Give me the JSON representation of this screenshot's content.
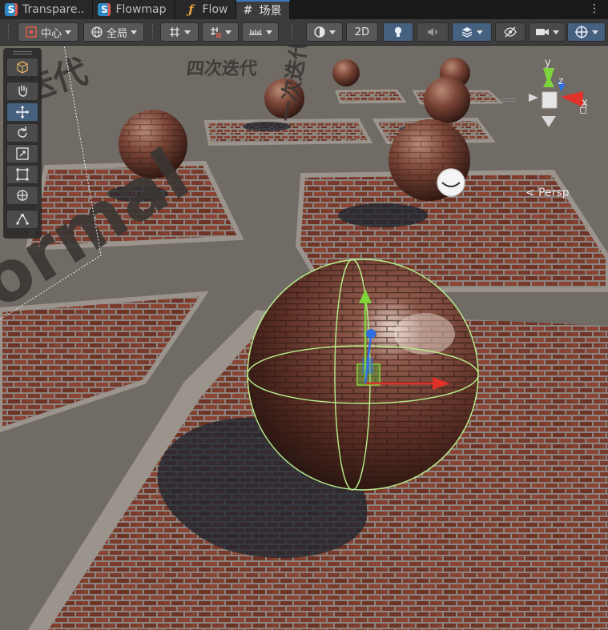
{
  "tabs": [
    {
      "label": "Transpare..",
      "icon": "shader-icon"
    },
    {
      "label": "Flowmap",
      "icon": "shader-icon"
    },
    {
      "label": "Flow",
      "icon": "script-function-icon"
    },
    {
      "label": "场景",
      "icon": "scene-grid-icon",
      "active": true
    }
  ],
  "toolbar": {
    "pivot_label": "中心",
    "space_label": "全局",
    "mode_2d_label": "2D"
  },
  "scene": {
    "projection_label": "< Persp",
    "gizmo_axes": {
      "x": "x",
      "y": "y",
      "z": "z"
    },
    "world_text": [
      "迭代",
      "四次迭代",
      "一次迭代",
      "ormal"
    ]
  },
  "colors": {
    "accent": "#3a79bb",
    "selected_tool": "#46607f",
    "axis_x": "#e0322a",
    "axis_y": "#7fd43b",
    "axis_z": "#2f6fe0",
    "selection_outline": "#b8f08a"
  }
}
